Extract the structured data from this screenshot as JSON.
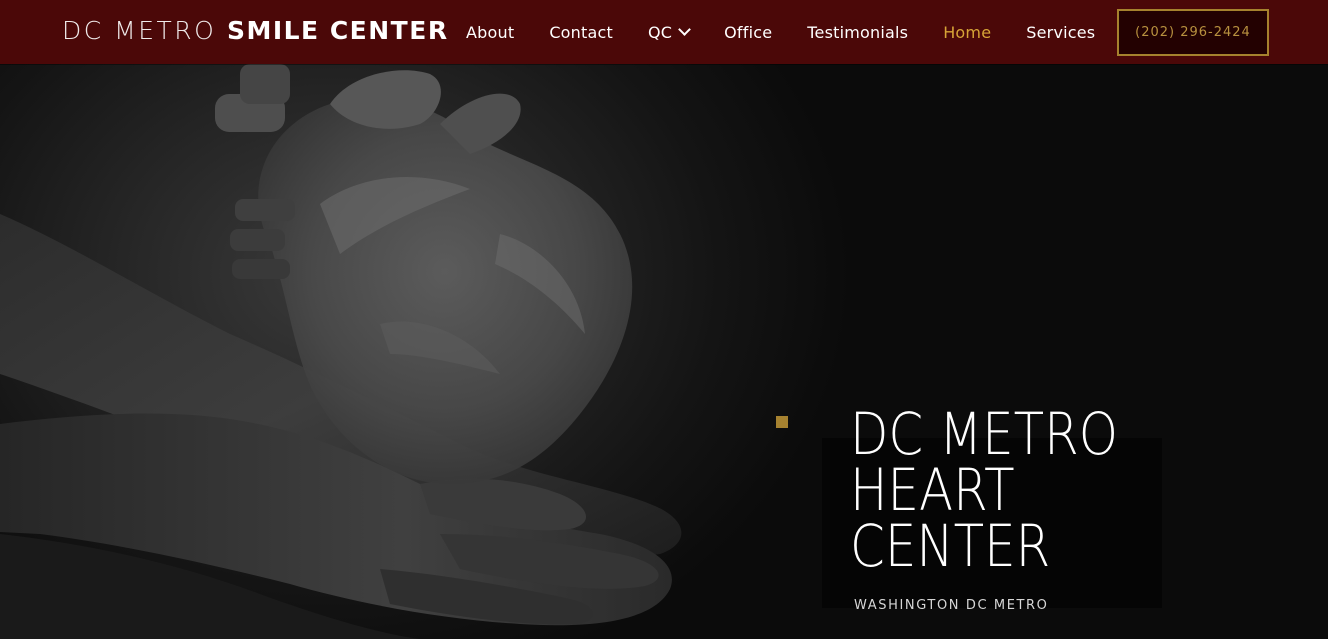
{
  "header": {
    "brand_light": "DC METRO",
    "brand_bold": "SMILE CENTER",
    "nav": [
      {
        "label": "About"
      },
      {
        "label": "Contact"
      },
      {
        "label": "QC"
      },
      {
        "label": "Office"
      },
      {
        "label": "Testimonials"
      },
      {
        "label": "Home"
      },
      {
        "label": "Services"
      }
    ],
    "phone": "(202) 296-2424"
  },
  "hero": {
    "title_lines": [
      "DC METRO",
      "HEART",
      "CENTER"
    ],
    "subtitle": "WASHINGTON DC METRO"
  },
  "colors": {
    "header_bg": "#4b0808",
    "accent_gold": "#d7a437",
    "button_border": "#a6822e",
    "hero_bg": "#0b0b0b"
  },
  "icons": {
    "dropdown": "chevron-down-icon"
  }
}
